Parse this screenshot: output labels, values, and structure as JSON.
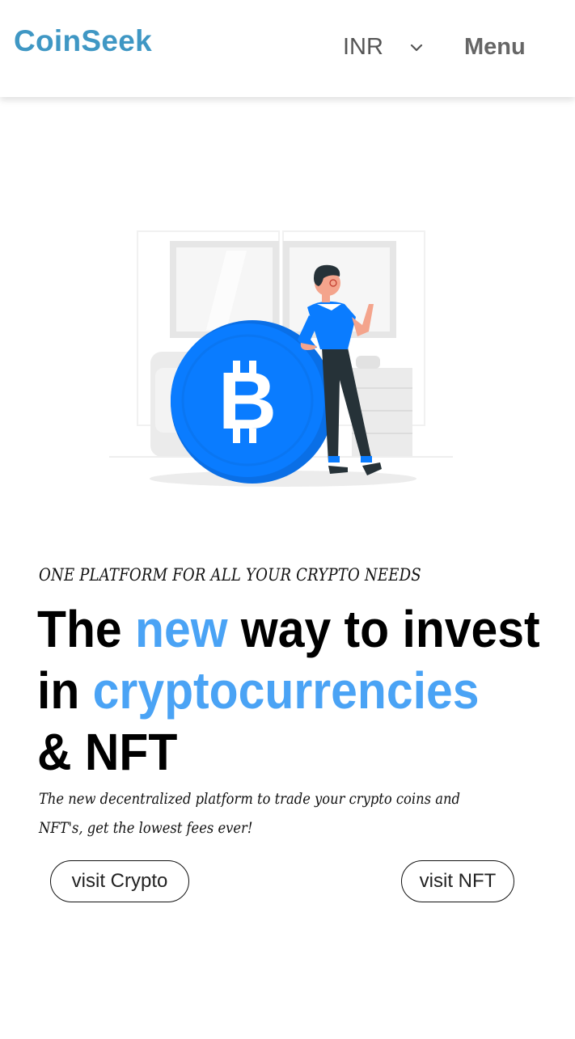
{
  "header": {
    "logo": "CoinSeek",
    "currency": "INR",
    "menu_label": "Menu"
  },
  "hero": {
    "tagline": "ONE PLATFORM FOR ALL YOUR CRYPTO NEEDS",
    "headline_part1": "The ",
    "headline_accent1": "new",
    "headline_part2": " way to invest",
    "headline_part3": "in ",
    "headline_accent2": "cryptocurrencies",
    "headline_part4": "& NFT",
    "description": "The new decentralized platform to trade your crypto coins and NFT's, get the lowest fees ever!",
    "buttons": {
      "crypto_label": "visit Crypto",
      "nft_label": "visit NFT"
    }
  },
  "colors": {
    "brand": "#3f97c4",
    "accent": "#4aa3f5",
    "coin": "#0a7cff"
  }
}
